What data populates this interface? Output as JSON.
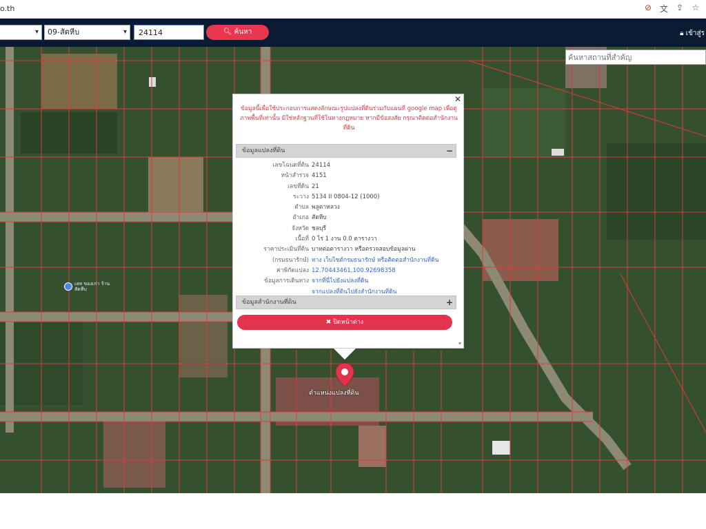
{
  "browser": {
    "url_fragment": "o.th",
    "icons": [
      "location-blocked-icon",
      "translate-icon",
      "share-icon",
      "bookmark-star-icon"
    ]
  },
  "header": {
    "province_select": "",
    "district_select": "09-สัตหีบ",
    "parcel_input": "24114",
    "search_label": "ค้นหา",
    "login_label": "เข้าสู่ร"
  },
  "map": {
    "place_search_placeholder": "ค้นหาสถานที่สำคัญ",
    "landmark_name": "เลท ของเก่า ร้านสัตหีบ",
    "marker_label": "ตำแหน่งแปลงที่ดิน"
  },
  "popup": {
    "disclaimer": "ข้อมูลนี้เพื่อใช้ประกอบการแสดงลักษณะรูปแปลงที่ดินร่วมกับแผนที่ google map เพื่อดูภาพพื้นที่เท่านั้น มิใช่หลักฐานที่ใช้ในทางกฎหมาย หากมีข้อสงสัย กรุณาติดต่อสำนักงานที่ดิน",
    "section_land": "ข้อมูลแปลงที่ดิน",
    "section_office": "ข้อมูลสำนักงานที่ดิน",
    "rows": [
      {
        "label": "เลขโฉนดที่ดิน",
        "value": "24114"
      },
      {
        "label": "หน้าสำรวจ",
        "value": "4151"
      },
      {
        "label": "เลขที่ดิน",
        "value": "21"
      },
      {
        "label": "ระวาง",
        "value": "5134 II 0804-12 (1000)"
      },
      {
        "label": "ตำบล",
        "value": "พลูตาหลวง"
      },
      {
        "label": "อำเภอ",
        "value": "สัตหีบ"
      },
      {
        "label": "จังหวัด",
        "value": "ชลบุรี"
      },
      {
        "label": "เนื้อที่",
        "value": "0 ไร่ 1 งาน 0.0 ตารางวา"
      },
      {
        "label": "ราคาประเมินที่ดิน",
        "value": "บาทต่อตารางวา หรือตรวจสอบข้อมูลผ่าน"
      },
      {
        "label": "(กรมธนารักษ์)",
        "value": "ทาง เว็บไซต์กรมธนารักษ์ หรือติดต่อสำนักงานที่ดิน"
      },
      {
        "label": "ค่าพิกัดแปลง",
        "value": "12.70443461,100.92698358"
      },
      {
        "label": "ข้อมูลการเดินทาง",
        "value": "จากที่นี่ไปยังแปลงที่ดิน"
      },
      {
        "label": "",
        "value": "จากแปลงที่ดินไปยังสำนักงานที่ดิน"
      }
    ],
    "close_button": "✖ ปิดหน้าต่าง"
  },
  "colors": {
    "header_bg": "#0b1a33",
    "accent_red": "#e2354d",
    "link_blue": "#3366cc",
    "parcel_line": "#e23a3a"
  }
}
